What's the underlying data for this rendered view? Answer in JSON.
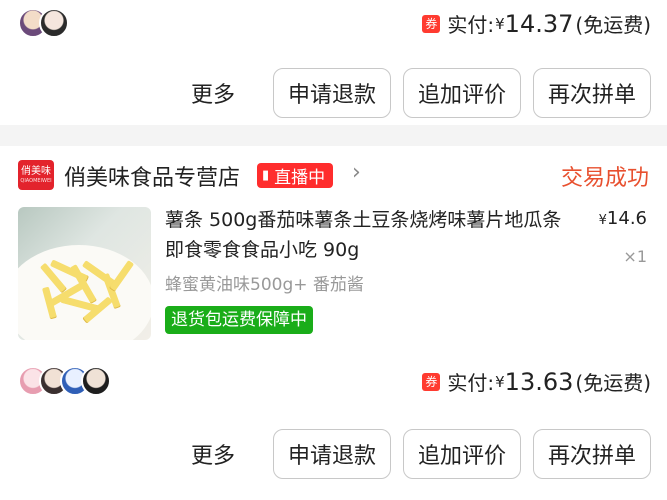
{
  "order1": {
    "avatars": [
      "avatar-1",
      "avatar-2"
    ],
    "coupon_label": "券",
    "pay_label": "实付:",
    "currency": "¥",
    "amount": "14.37",
    "shipping_note": "(免运费)",
    "more_label": "更多",
    "buttons": [
      "申请退款",
      "追加评价",
      "再次拼单"
    ]
  },
  "order2": {
    "shop": {
      "logo_text": "俏美味",
      "logo_subtext": "QIAOMEIWEI",
      "name": "俏美味食品专营店",
      "live_icon": "live-bars-icon",
      "live_label": "直播中",
      "chevron": "›"
    },
    "status": "交易成功",
    "product": {
      "title": "薯条 500g番茄味薯条土豆条烧烤味薯片地瓜条即食零食食品小吃 90g",
      "price_currency": "¥",
      "price": "14.6",
      "quantity": "×1",
      "spec": "蜂蜜黄油味500g+ 番茄酱",
      "guarantee": "退货包运费保障中"
    },
    "avatars": [
      "avatar-3",
      "avatar-4",
      "avatar-5",
      "avatar-6"
    ],
    "coupon_label": "券",
    "pay_label": "实付:",
    "currency": "¥",
    "amount": "13.63",
    "shipping_note": "(免运费)",
    "more_label": "更多",
    "buttons": [
      "申请退款",
      "追加评价",
      "再次拼单"
    ]
  },
  "colors": {
    "coupon": "#ff3b30",
    "live": "#ff2d2d",
    "status": "#e8502f",
    "guarantee": "#1aad19",
    "shop_logo": "#e3232c"
  }
}
